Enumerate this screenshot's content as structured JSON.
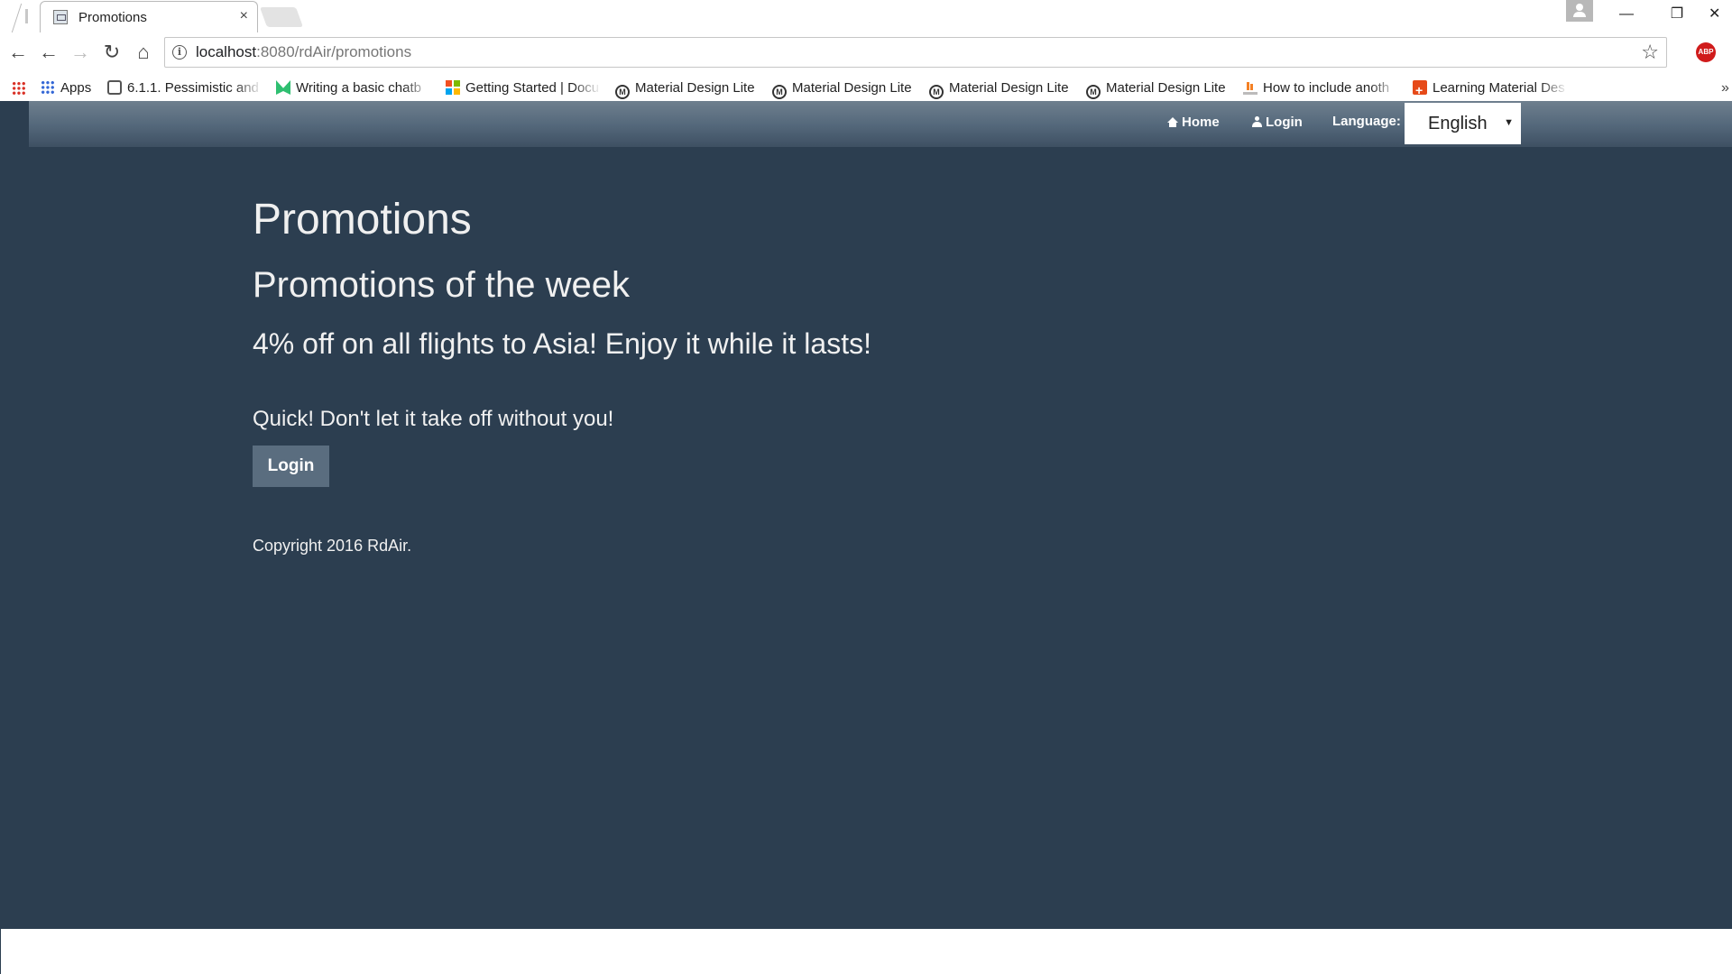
{
  "browser": {
    "tab_title": "Promotions",
    "tab_close": "×",
    "url_host": "localhost",
    "url_rest": ":8080/rdAir/promotions",
    "window": {
      "minimize": "—",
      "maximize": "❐",
      "close": "✕"
    },
    "nav": {
      "back": "←",
      "forward": "→",
      "reload": "↻",
      "home": "⌂",
      "star": "☆",
      "abp": "ABP"
    },
    "bookmarks": [
      {
        "label": "Apps",
        "icon": "apps-icon"
      },
      {
        "label": "6.1.1. Pessimistic and",
        "icon": "doc-icon"
      },
      {
        "label": "Writing a basic chatb",
        "icon": "leaf-icon"
      },
      {
        "label": "Getting Started | Docu",
        "icon": "microsoft-icon"
      },
      {
        "label": "Material Design Lite",
        "icon": "mdl-icon"
      },
      {
        "label": "Material Design Lite",
        "icon": "mdl-icon"
      },
      {
        "label": "Material Design Lite",
        "icon": "mdl-icon"
      },
      {
        "label": "Material Design Lite",
        "icon": "mdl-icon"
      },
      {
        "label": "How to include anoth",
        "icon": "stackoverflow-icon"
      },
      {
        "label": "Learning Material Des",
        "icon": "plus-icon"
      }
    ],
    "bookmarks_more": "»"
  },
  "site_nav": {
    "home": "Home",
    "login": "Login",
    "language_label": "Language:",
    "language_value": "English",
    "caret": "▼"
  },
  "main": {
    "title": "Promotions",
    "subtitle": "Promotions of the week",
    "promo": "4% off on all flights to Asia! Enjoy it while it lasts!",
    "cta_text": "Quick! Don't let it take off without you!",
    "login_button": "Login",
    "copyright": "Copyright 2016 RdAir."
  },
  "colors": {
    "page_bg": "#2c3e50",
    "navbar_top": "#6f7f8e",
    "navbar_bottom": "#3e5062",
    "button_bg": "#5a6d7f",
    "text": "#f0f0f0"
  }
}
